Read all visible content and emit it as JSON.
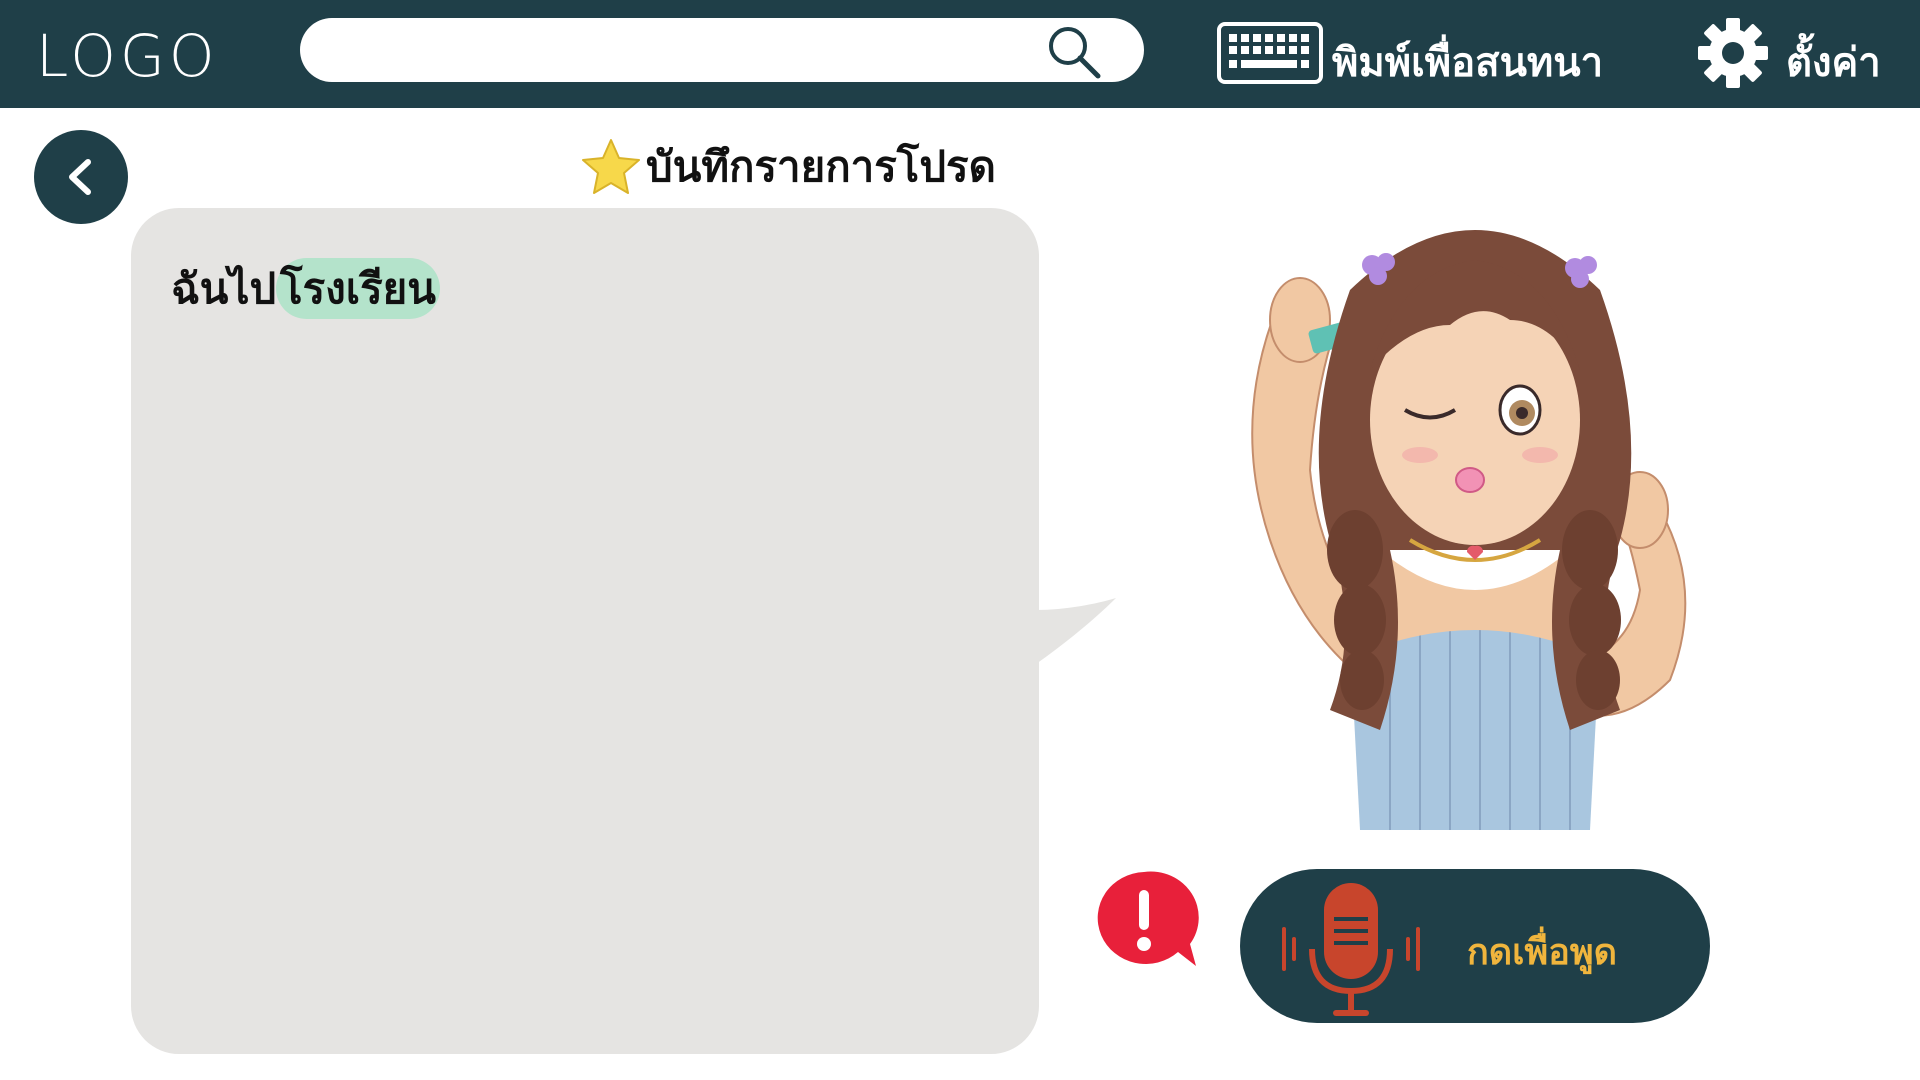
{
  "header": {
    "logo": "LOGO",
    "search": {
      "placeholder": "",
      "value": "",
      "icon": "search-icon"
    },
    "chat": {
      "label": "พิมพ์เพื่อสนทนา",
      "icon": "keyboard-icon"
    },
    "settings": {
      "label": "ตั้งค่า",
      "icon": "gear-icon"
    }
  },
  "page": {
    "back_icon": "chevron-left-icon",
    "title": "บันทึกรายการโปรด",
    "title_icon": "star-icon"
  },
  "bubble": {
    "prefix": "ฉันไป",
    "highlight": "โรงเรียน"
  },
  "controls": {
    "alert_icon": "alert-icon",
    "talk_label": "กดเพื่อพูด",
    "talk_icon": "microphone-icon"
  },
  "colors": {
    "primary": "#1f3f48",
    "bubble": "#e5e4e2",
    "highlight": "#b4e3cb",
    "talk_text": "#f0b53d",
    "mic": "#c8452c",
    "alert": "#e8203a",
    "star": "#f7d84a"
  }
}
